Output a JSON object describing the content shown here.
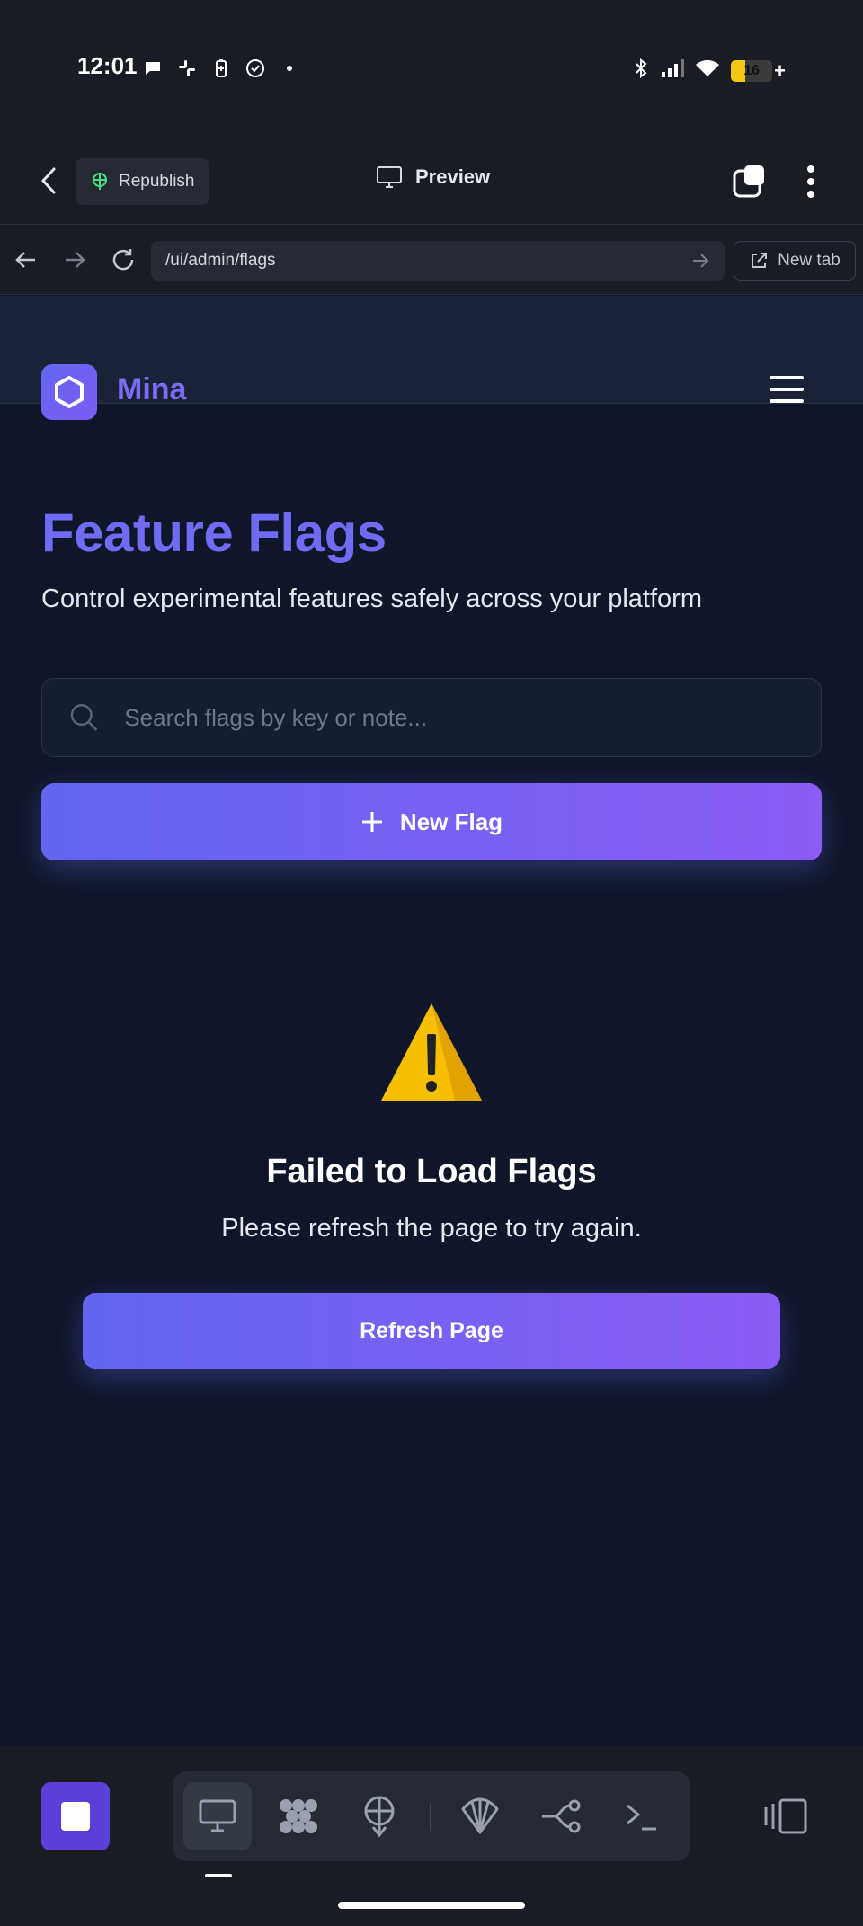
{
  "status_bar": {
    "time": "12:01",
    "battery_level": "16",
    "left_icons": [
      "message-bubble-icon",
      "slack-icon",
      "battery-saver-icon",
      "check-circle-icon",
      "dot-icon"
    ],
    "right_icons": [
      "bluetooth-icon",
      "signal-icon",
      "wifi-icon",
      "battery-icon"
    ]
  },
  "app_header": {
    "republish_label": "Republish",
    "preview_label": "Preview"
  },
  "url_bar": {
    "url": "/ui/admin/flags",
    "new_tab_label": "New tab"
  },
  "site": {
    "brand_name": "Mina",
    "title": "Feature Flags",
    "subtitle": "Control experimental features safely across your platform",
    "search_placeholder": "Search flags by key or note...",
    "new_flag_label": "New Flag",
    "error_title": "Failed to Load Flags",
    "error_message": "Please refresh the page to try again.",
    "refresh_label": "Refresh Page"
  },
  "bottom_toolbar": {
    "tools": [
      "desktop-icon",
      "dots-grid-icon",
      "deploy-icon",
      "shell-icon",
      "branch-icon",
      "terminal-icon"
    ],
    "active_tool": "desktop-icon"
  },
  "colors": {
    "page_bg": "#0f1629",
    "chrome_bg": "#191c25",
    "accent_start": "#6366f1",
    "accent_end": "#8b5cf6",
    "brand_text": "#7b6cf6"
  }
}
